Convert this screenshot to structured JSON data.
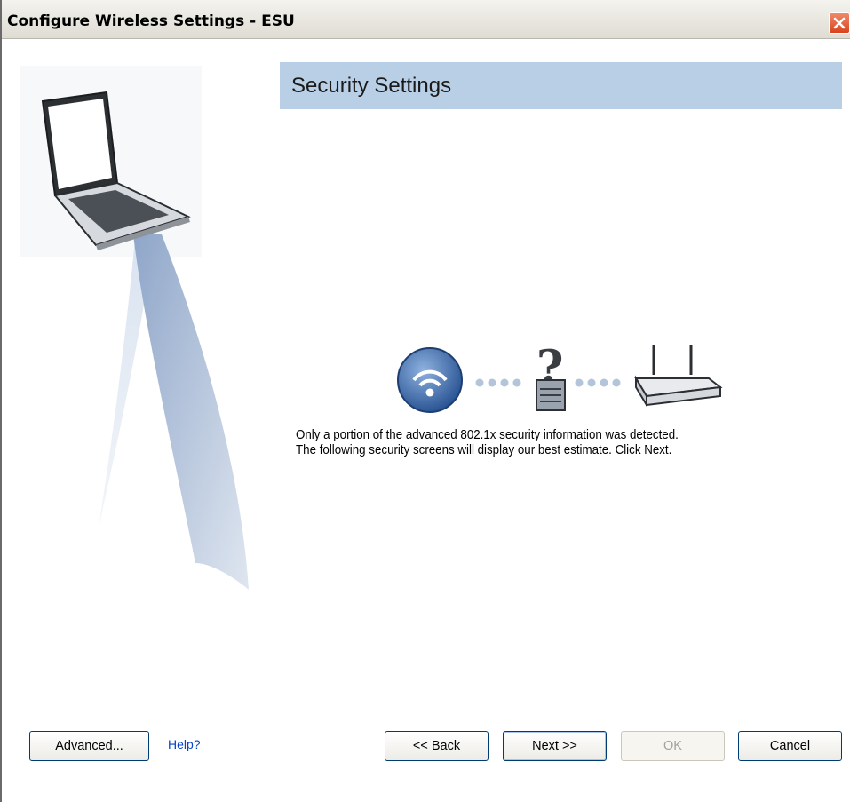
{
  "window": {
    "title": "Configure Wireless Settings - ESU"
  },
  "banner": {
    "title": "Security Settings"
  },
  "message": {
    "line1": "Only a portion of the advanced 802.1x security information was detected.",
    "line2": "The following security screens will display our best estimate. Click Next."
  },
  "buttons": {
    "advanced": "Advanced...",
    "help": "Help?",
    "back": "<< Back",
    "next": "Next >>",
    "ok": "OK",
    "cancel": "Cancel"
  },
  "icons": {
    "laptop": "laptop-icon",
    "wireless": "wireless-signal-icon",
    "lock": "question-lock-icon",
    "router": "router-icon",
    "close": "close-icon"
  },
  "colors": {
    "banner": "#b8cfe6",
    "help_link": "#0645c8",
    "close_button": "#d8421d"
  }
}
